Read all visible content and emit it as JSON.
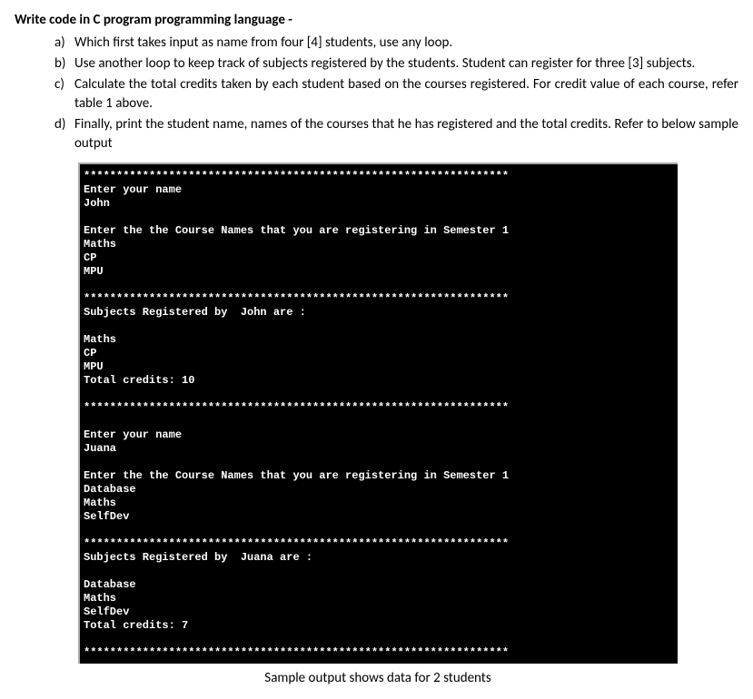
{
  "title": "Write code in C program programming language -",
  "items": [
    {
      "marker": "a)",
      "text": "Which first takes input as name from four [4] students, use any loop."
    },
    {
      "marker": "b)",
      "text": "Use another loop to keep track of subjects registered by the students. Student can register for three [3] subjects."
    },
    {
      "marker": "c)",
      "text": "Calculate the total credits taken by each student based on the courses registered. For credit value of each course, refer table 1 above."
    },
    {
      "marker": "d)",
      "text": "Finally, print the student name, names of the courses that he has registered and the total credits. Refer to below sample output"
    }
  ],
  "terminal": {
    "line1": "*****************************************************************",
    "line2": "Enter your name",
    "line3": "John",
    "line4": "",
    "line5": "Enter the the Course Names that you are registering in Semester 1",
    "line6": "Maths",
    "line7": "CP",
    "line8": "MPU",
    "line9": "",
    "line10": "*****************************************************************",
    "line11": "Subjects Registered by  John are :",
    "line12": "",
    "line13": "Maths",
    "line14": "CP",
    "line15": "MPU",
    "line16": "Total credits: 10",
    "line17": "",
    "line18": "*****************************************************************",
    "line19": "",
    "line20": "Enter your name",
    "line21": "Juana",
    "line22": "",
    "line23": "Enter the the Course Names that you are registering in Semester 1",
    "line24": "Database",
    "line25": "Maths",
    "line26": "SelfDev",
    "line27": "",
    "line28": "*****************************************************************",
    "line29": "Subjects Registered by  Juana are :",
    "line30": "",
    "line31": "Database",
    "line32": "Maths",
    "line33": "SelfDev",
    "line34": "Total credits: 7",
    "line35": "",
    "line36": "*****************************************************************"
  },
  "caption": "Sample output shows data for 2 students"
}
